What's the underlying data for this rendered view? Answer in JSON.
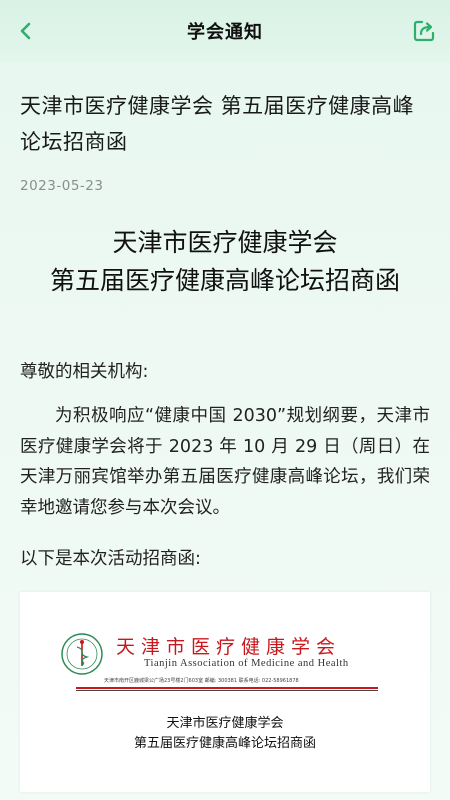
{
  "header": {
    "title": "学会通知",
    "back_icon": "chevron-left-icon",
    "share_icon": "share-icon",
    "accent_color": "#2fae6e"
  },
  "article": {
    "title": "天津市医疗健康学会 第五届医疗健康高峰论坛招商函",
    "date": "2023-05-23",
    "heading_line1": "天津市医疗健康学会",
    "heading_line2": "第五届医疗健康高峰论坛招商函",
    "salutation": "尊敬的相关机构:",
    "paragraph": "为积极响应“健康中国 2030”规划纲要，天津市医疗健康学会将于 2023 年 10 月 29 日（周日）在天津万丽宾馆举办第五届医疗健康高峰论坛，我们荣幸地邀请您参与本次会议。",
    "intro": "以下是本次活动招商函:"
  },
  "letter_image": {
    "org_cn": "天津市医疗健康学会",
    "org_en": "Tianjin Association of Medicine and Health",
    "address": "天津市南开区鹿城梁公广场23号楼2门603室     邮编: 300381     联系电话: 022-58961878",
    "title_line1": "天津市医疗健康学会",
    "title_line2": "第五届医疗健康高峰论坛招商函"
  }
}
